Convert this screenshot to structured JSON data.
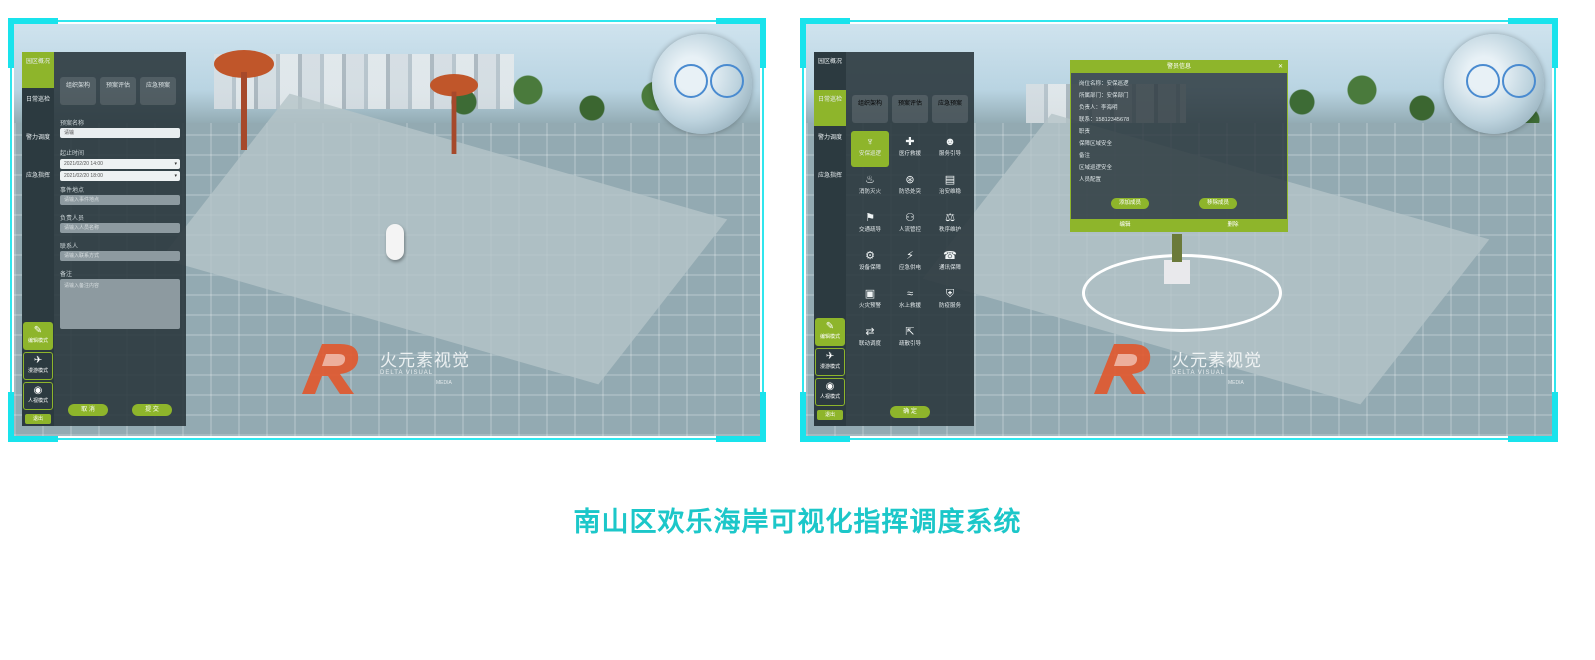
{
  "left_screen": {
    "nav_tabs": [
      "园区概况",
      "日常巡检",
      "警力调度",
      "应急指挥"
    ],
    "panel": {
      "category_buttons": [
        "组织架构",
        "预案评估",
        "应急预案"
      ],
      "form": {
        "section_title": "预案名称",
        "name_value": "请输",
        "time_label": "起止时间",
        "start_select": "2021/02/20 14:00",
        "end_select": "2021/02/20 18:00",
        "location_label": "事件地点",
        "location_placeholder": "请输入事件地点",
        "people_label": "负责人员",
        "people_placeholder": "请输入人员名称",
        "contact_label": "联系人",
        "contact_placeholder": "请输入联系方式",
        "remark_label": "备注",
        "remark_placeholder": "请输入备注内容"
      },
      "buttons": {
        "cancel": "取 消",
        "submit": "提 交"
      }
    },
    "tools": [
      {
        "label": "编辑模式",
        "icon": "edit-icon"
      },
      {
        "label": "漫游模式",
        "icon": "roam-icon"
      },
      {
        "label": "人视模式",
        "icon": "eye-icon"
      }
    ],
    "small_button": "退出"
  },
  "right_screen": {
    "nav_tabs": [
      "园区概况",
      "日常巡检",
      "警力调度",
      "应急指挥"
    ],
    "categories": [
      "组织架构",
      "预案评估",
      "应急预案"
    ],
    "grid_items": [
      {
        "label": "安保巡逻",
        "icon": "guard-icon"
      },
      {
        "label": "医疗救援",
        "icon": "medical-icon"
      },
      {
        "label": "服务引导",
        "icon": "service-icon"
      },
      {
        "label": "消防灭火",
        "icon": "fire-icon"
      },
      {
        "label": "防恐处突",
        "icon": "alarm-icon"
      },
      {
        "label": "治安维稳",
        "icon": "document-icon"
      },
      {
        "label": "交通疏导",
        "icon": "traffic-icon"
      },
      {
        "label": "人流管控",
        "icon": "crowd-icon"
      },
      {
        "label": "秩序维护",
        "icon": "order-icon"
      },
      {
        "label": "设备保障",
        "icon": "device-icon"
      },
      {
        "label": "应急供电",
        "icon": "power-icon"
      },
      {
        "label": "通讯保障",
        "icon": "comm-icon"
      },
      {
        "label": "火灾预警",
        "icon": "firewarn-icon"
      },
      {
        "label": "水上救援",
        "icon": "water-icon"
      },
      {
        "label": "防疫服务",
        "icon": "shield-icon"
      },
      {
        "label": "联动调度",
        "icon": "link-icon"
      },
      {
        "label": "疏散引导",
        "icon": "evacuate-icon"
      }
    ],
    "confirm_button": "确 定",
    "dialog": {
      "title": "警员信息",
      "rows": [
        "岗位名称：安保巡逻",
        "所属部门：安保部门",
        "负责人：李海明",
        "联系：15812345678",
        "职责",
        "保障区域安全",
        "备注",
        "区域巡逻安全",
        "人员配置"
      ],
      "button_a": "添加成员",
      "button_b": "移除成员",
      "footer_left": "编辑",
      "footer_right": "删除"
    },
    "tools": [
      {
        "label": "编辑模式",
        "icon": "edit-icon"
      },
      {
        "label": "漫游模式",
        "icon": "roam-icon"
      },
      {
        "label": "人视模式",
        "icon": "eye-icon"
      }
    ],
    "small_button": "退出"
  },
  "watermark": {
    "cn": "火元素视觉",
    "en": "DELTA VISUAL",
    "en2": "MEDIA"
  },
  "caption": "南山区欢乐海岸可视化指挥调度系统",
  "colors": {
    "frame": "#19e3ec",
    "accent": "#8eb52b",
    "caption": "#1cc7c9"
  }
}
